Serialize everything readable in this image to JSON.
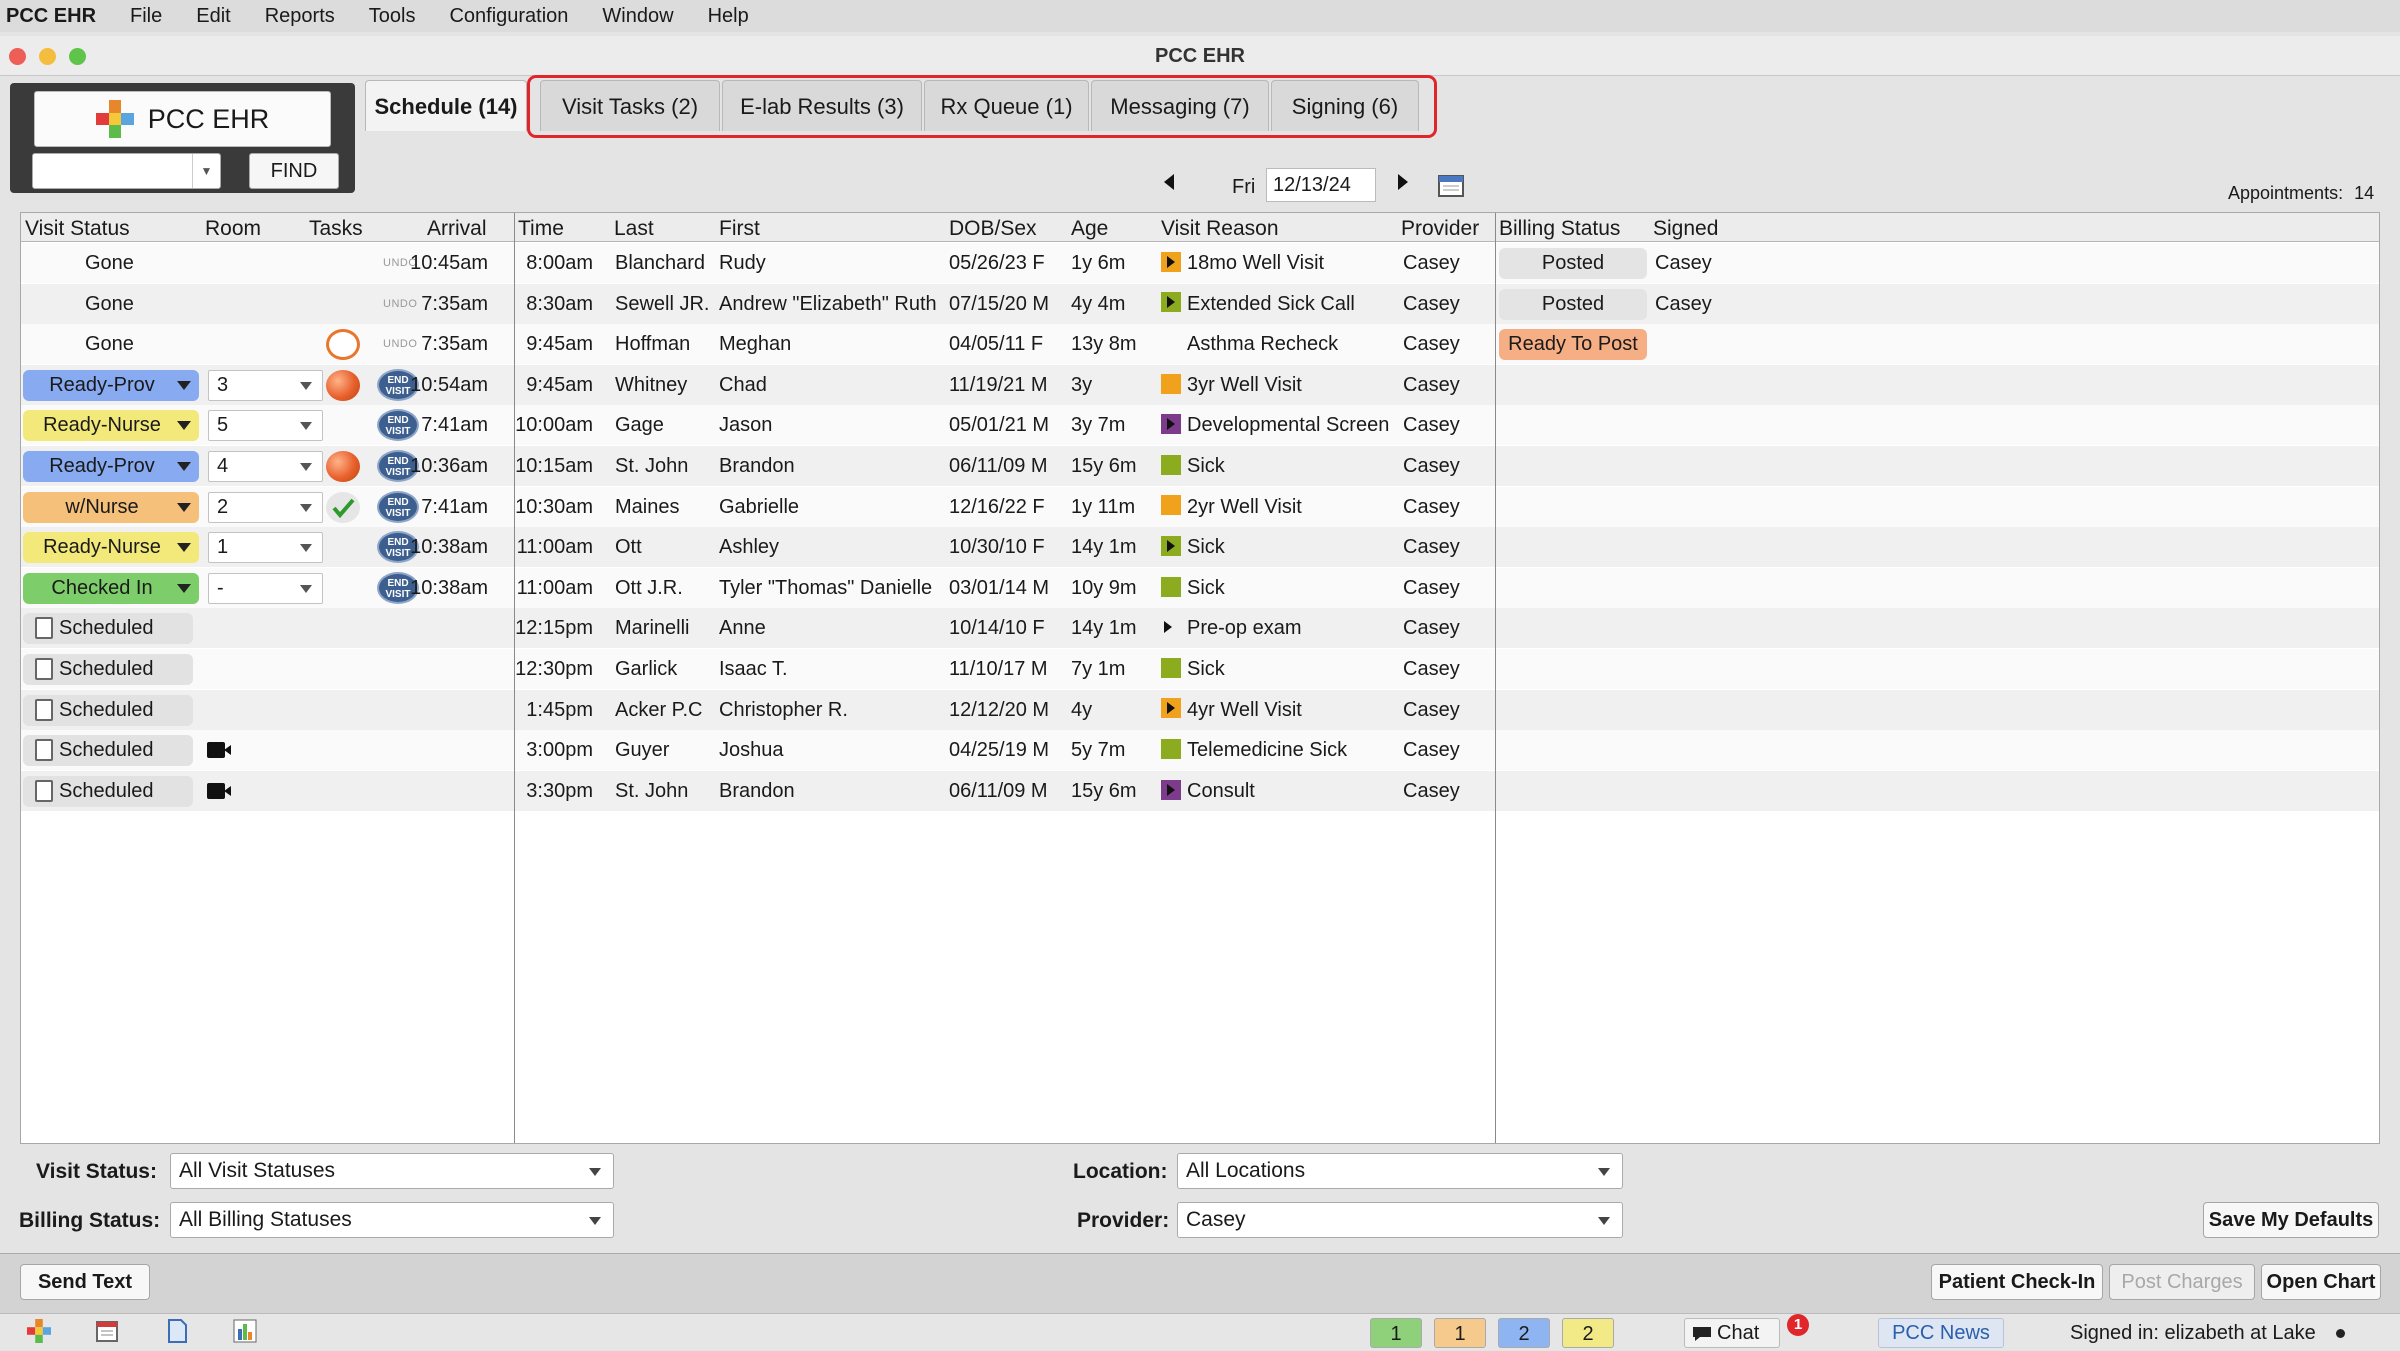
{
  "menubar": {
    "app": "PCC EHR",
    "items": [
      "File",
      "Edit",
      "Reports",
      "Tools",
      "Configuration",
      "Window",
      "Help"
    ]
  },
  "window": {
    "title": "PCC EHR"
  },
  "logo": {
    "text": "PCC EHR",
    "find_label": "FIND",
    "find_value": ""
  },
  "tabs": [
    {
      "label": "Schedule (14)",
      "active": true
    },
    {
      "label": "Visit Tasks (2)"
    },
    {
      "label": "E-lab Results (3)"
    },
    {
      "label": "Rx Queue (1)"
    },
    {
      "label": "Messaging (7)"
    },
    {
      "label": "Signing (6)"
    }
  ],
  "datenav": {
    "day": "Fri",
    "date": "12/13/24"
  },
  "appointments": {
    "label": "Appointments:",
    "count": "14"
  },
  "columns": [
    "Visit Status",
    "Room",
    "Tasks",
    "Arrival",
    "Time",
    "Last",
    "First",
    "DOB/Sex",
    "Age",
    "Visit Reason",
    "Provider",
    "Billing Status",
    "Signed"
  ],
  "rows": [
    {
      "status": "Gone",
      "room": "",
      "arrival": "10:45am",
      "undo": "UNDO",
      "time": "8:00am",
      "last": "Blanchard",
      "first": "Rudy",
      "dob": "05/26/23 F",
      "age": "1y 6m",
      "reason": "18mo Well Visit",
      "provider": "Casey",
      "billing": "Posted",
      "signed": "Casey"
    },
    {
      "status": "Gone",
      "room": "",
      "arrival": "7:35am",
      "undo": "UNDO",
      "time": "8:30am",
      "last": "Sewell JR.",
      "first": "Andrew \"Elizabeth\" Ruth",
      "dob": "07/15/20 M",
      "age": "4y 4m",
      "reason": "Extended Sick Call",
      "provider": "Casey",
      "billing": "Posted",
      "signed": "Casey"
    },
    {
      "status": "Gone",
      "room": "",
      "arrival": "7:35am",
      "undo": "UNDO",
      "time": "9:45am",
      "last": "Hoffman",
      "first": "Meghan",
      "dob": "04/05/11 F",
      "age": "13y 8m",
      "reason": "Asthma Recheck",
      "provider": "Casey",
      "billing": "Ready To Post",
      "signed": ""
    },
    {
      "status": "Ready-Prov",
      "room": "3",
      "arrival": "10:54am",
      "endvisit": "END VISIT",
      "time": "9:45am",
      "last": "Whitney",
      "first": "Chad",
      "dob": "11/19/21 M",
      "age": "3y",
      "reason": "3yr Well Visit",
      "provider": "Casey",
      "billing": "",
      "signed": ""
    },
    {
      "status": "Ready-Nurse",
      "room": "5",
      "arrival": "7:41am",
      "endvisit": "END VISIT",
      "time": "10:00am",
      "last": "Gage",
      "first": "Jason",
      "dob": "05/01/21 M",
      "age": "3y 7m",
      "reason": "Developmental Screen",
      "provider": "Casey",
      "billing": "",
      "signed": ""
    },
    {
      "status": "Ready-Prov",
      "room": "4",
      "arrival": "10:36am",
      "endvisit": "END VISIT",
      "time": "10:15am",
      "last": "St. John",
      "first": "Brandon",
      "dob": "06/11/09 M",
      "age": "15y 6m",
      "reason": "Sick",
      "provider": "Casey",
      "billing": "",
      "signed": ""
    },
    {
      "status": "w/Nurse",
      "room": "2",
      "arrival": "7:41am",
      "endvisit": "END VISIT",
      "time": "10:30am",
      "last": "Maines",
      "first": "Gabrielle",
      "dob": "12/16/22 F",
      "age": "1y 11m",
      "reason": "2yr Well Visit",
      "provider": "Casey",
      "billing": "",
      "signed": ""
    },
    {
      "status": "Ready-Nurse",
      "room": "1",
      "arrival": "10:38am",
      "endvisit": "END VISIT",
      "time": "11:00am",
      "last": "Ott",
      "first": "Ashley",
      "dob": "10/30/10 F",
      "age": "14y 1m",
      "reason": "Sick",
      "provider": "Casey",
      "billing": "",
      "signed": ""
    },
    {
      "status": "Checked In",
      "room": "-",
      "arrival": "10:38am",
      "endvisit": "END VISIT",
      "time": "11:00am",
      "last": "Ott J.R.",
      "first": "Tyler \"Thomas\" Danielle",
      "dob": "03/01/14 M",
      "age": "10y 9m",
      "reason": "Sick",
      "provider": "Casey",
      "billing": "",
      "signed": ""
    },
    {
      "status": "Scheduled",
      "room": "",
      "arrival": "",
      "time": "12:15pm",
      "last": "Marinelli",
      "first": "Anne",
      "dob": "10/14/10 F",
      "age": "14y 1m",
      "reason": "Pre-op exam",
      "provider": "Casey",
      "billing": "",
      "signed": ""
    },
    {
      "status": "Scheduled",
      "room": "",
      "arrival": "",
      "time": "12:30pm",
      "last": "Garlick",
      "first": "Isaac T.",
      "dob": "11/10/17 M",
      "age": "7y 1m",
      "reason": "Sick",
      "provider": "Casey",
      "billing": "",
      "signed": ""
    },
    {
      "status": "Scheduled",
      "room": "",
      "arrival": "",
      "time": "1:45pm",
      "last": "Acker P.C",
      "first": "Christopher R.",
      "dob": "12/12/20 M",
      "age": "4y",
      "reason": "4yr Well Visit",
      "provider": "Casey",
      "billing": "",
      "signed": ""
    },
    {
      "status": "Scheduled",
      "room": "",
      "arrival": "",
      "time": "3:00pm",
      "last": "Guyer",
      "first": "Joshua",
      "dob": "04/25/19 M",
      "age": "5y 7m",
      "reason": "Telemedicine Sick",
      "provider": "Casey",
      "billing": "",
      "signed": ""
    },
    {
      "status": "Scheduled",
      "room": "",
      "arrival": "",
      "time": "3:30pm",
      "last": "St. John",
      "first": "Brandon",
      "dob": "06/11/09 M",
      "age": "15y 6m",
      "reason": "Consult",
      "provider": "Casey",
      "billing": "",
      "signed": ""
    }
  ],
  "filters": {
    "visit_status_label": "Visit Status:",
    "visit_status_value": "All Visit Statuses",
    "billing_status_label": "Billing Status:",
    "billing_status_value": "All Billing Statuses",
    "location_label": "Location:",
    "location_value": "All Locations",
    "provider_label": "Provider:",
    "provider_value": "Casey",
    "save_defaults": "Save My Defaults"
  },
  "bottom": {
    "send_text": "Send Text",
    "check_in": "Patient Check-In",
    "post_charges": "Post Charges",
    "open_chart": "Open Chart"
  },
  "status": {
    "counts": [
      "1",
      "1",
      "2",
      "2"
    ],
    "chat": "Chat",
    "chat_badge": "1",
    "news": "PCC News",
    "signed_in": "Signed in: elizabeth at Lake"
  },
  "colors": {
    "ready_prov": "#88aaf0",
    "ready_nurse": "#f3e97a",
    "w_nurse": "#f5c07a",
    "checked_in": "#7dce6a",
    "scheduled": "#e2e2e2",
    "ready_to_post": "#f6ae85",
    "posted": "#e4e4e4",
    "highlight": "#e0262b"
  }
}
